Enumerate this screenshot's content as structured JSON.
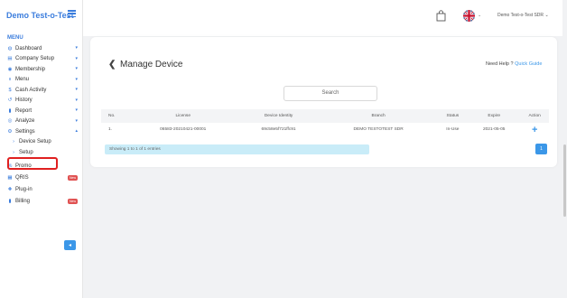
{
  "brand": "Demo Test-o-Test",
  "menu_title": "MENU",
  "nav": [
    {
      "label": "Dashboard",
      "icon": "dashboard-icon",
      "glyph": "◍",
      "caret": true
    },
    {
      "label": "Company Setup",
      "icon": "building-icon",
      "glyph": "▤",
      "caret": true
    },
    {
      "label": "Membership",
      "icon": "member-icon",
      "glyph": "◉",
      "caret": true
    },
    {
      "label": "Menu",
      "icon": "fork-icon",
      "glyph": "ıı",
      "caret": true
    },
    {
      "label": "Cash Activity",
      "icon": "dollar-icon",
      "glyph": "$",
      "caret": true
    },
    {
      "label": "History",
      "icon": "history-icon",
      "glyph": "↺",
      "caret": true
    },
    {
      "label": "Report",
      "icon": "report-icon",
      "glyph": "▮",
      "caret": true
    },
    {
      "label": "Analyze",
      "icon": "analyze-icon",
      "glyph": "◎",
      "caret": true
    },
    {
      "label": "Settings",
      "icon": "gear-icon",
      "glyph": "⚙",
      "caret_up": true
    },
    {
      "label": "Device Setup",
      "icon": "chevron-right-icon",
      "glyph": "›",
      "sub": true
    },
    {
      "label": "Setup",
      "icon": "chevron-right-icon",
      "glyph": "›",
      "sub": true
    },
    {
      "label": "Promo",
      "icon": "percent-icon",
      "glyph": "%"
    },
    {
      "label": "QRIS",
      "icon": "qr-icon",
      "glyph": "▦",
      "badge": "New"
    },
    {
      "label": "Plug-in",
      "icon": "plugin-icon",
      "glyph": "✚"
    },
    {
      "label": "Billing",
      "icon": "billing-icon",
      "glyph": "▮",
      "badge": "New"
    }
  ],
  "topbar": {
    "user_name": "Demo Test-o-Test SDR",
    "flag_caret": "⌄",
    "user_caret": "⌄"
  },
  "page": {
    "back_glyph": "❮",
    "title": "Manage Device",
    "help_text": "Need Help ?",
    "help_link": "Quick Guide",
    "search_placeholder": "Search"
  },
  "table": {
    "headers": [
      "No.",
      "License",
      "Device Identity",
      "Branch",
      "Status",
      "Expire",
      "Action"
    ],
    "rows": [
      [
        "1.",
        "06583-20210421-00001",
        "69c58e5f721ffc91",
        "DEMO TESTOTEST SDR",
        "In-Use",
        "2021-05-05"
      ]
    ],
    "action_glyph": "+"
  },
  "footer": {
    "info": "Showing 1 to 1 of 1 entries",
    "page": "1"
  },
  "collapse_glyph": "◂",
  "colors": {
    "accent": "#3b97e8",
    "highlight": "#e02020"
  }
}
